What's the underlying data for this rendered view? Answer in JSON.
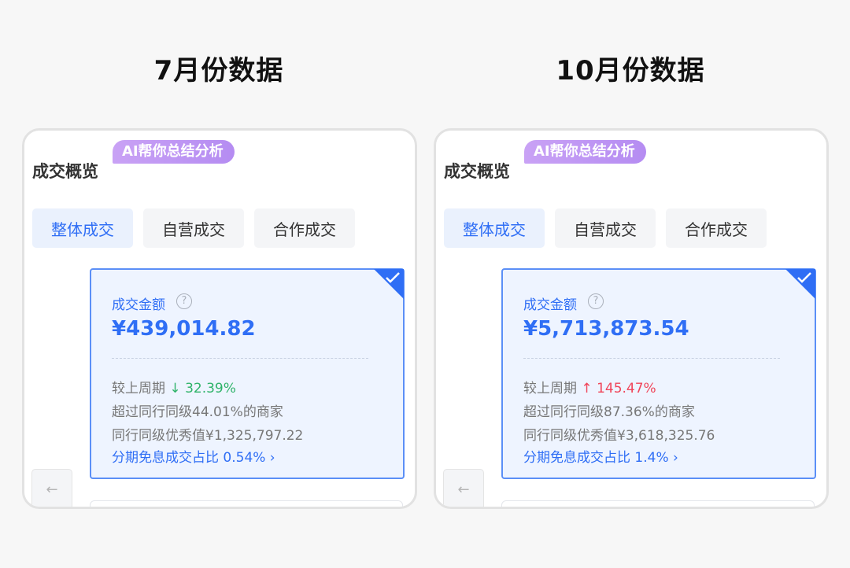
{
  "panels": [
    {
      "heading": "7月份数据",
      "overview_title": "成交概览",
      "ai_badge": "AI帮你总结分析",
      "tabs": [
        "整体成交",
        "自营成交",
        "合作成交"
      ],
      "active_tab": "整体成交",
      "metric": {
        "label": "成交金额",
        "value": "¥439,014.82",
        "compare_label": "较上周期",
        "change_arrow": "↓",
        "change_value": "32.39%",
        "change_direction": "down",
        "peer_rank": "超过同行同级44.01%的商家",
        "peer_excellent": "同行同级优秀值¥1,325,797.22",
        "installment_link": "分期免息成交占比 0.54% ›"
      },
      "back_icon": "arrow-left-icon"
    },
    {
      "heading": "10月份数据",
      "overview_title": "成交概览",
      "ai_badge": "AI帮你总结分析",
      "tabs": [
        "整体成交",
        "自营成交",
        "合作成交"
      ],
      "active_tab": "整体成交",
      "metric": {
        "label": "成交金额",
        "value": "¥5,713,873.54",
        "compare_label": "较上周期",
        "change_arrow": "↑",
        "change_value": "145.47%",
        "change_direction": "up",
        "peer_rank": "超过同行同级87.36%的商家",
        "peer_excellent": "同行同级优秀值¥3,618,325.76",
        "installment_link": "分期免息成交占比 1.4% ›"
      },
      "back_icon": "arrow-left-icon"
    }
  ],
  "colors": {
    "accent_blue": "#2f6ef5",
    "card_bg": "#eef4ff",
    "down_green": "#2fb36a",
    "up_red": "#f0455a",
    "ai_purple": "#b58cf2"
  }
}
